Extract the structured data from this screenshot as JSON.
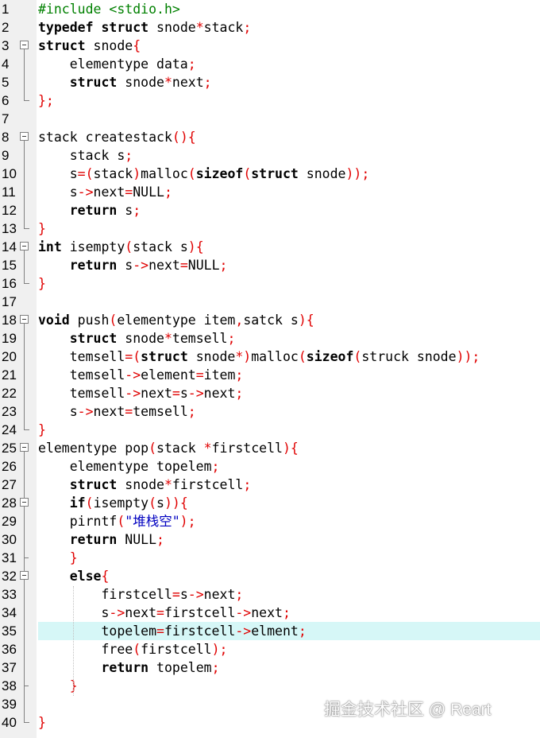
{
  "editor": {
    "colors": {
      "keyword": "#000000",
      "preprocessor": "#008000",
      "operator": "#e00000",
      "text": "#000000",
      "string": "#0000c0",
      "line_highlight": "#d6f7f7",
      "gutter": "#f0f0f0"
    },
    "highlighted_line": 35,
    "lines": [
      {
        "n": "1",
        "fold": "",
        "tokens": [
          [
            "pp",
            "#include <stdio.h>"
          ]
        ]
      },
      {
        "n": "2",
        "fold": "",
        "tokens": [
          [
            "kw",
            "typedef"
          ],
          [
            "tx",
            " "
          ],
          [
            "kw",
            "struct"
          ],
          [
            "tx",
            " snode"
          ],
          [
            "op",
            "*"
          ],
          [
            "tx",
            "stack"
          ],
          [
            "op",
            ";"
          ]
        ]
      },
      {
        "n": "3",
        "fold": "open",
        "tokens": [
          [
            "kw",
            "struct"
          ],
          [
            "tx",
            " snode"
          ],
          [
            "op",
            "{"
          ]
        ]
      },
      {
        "n": "4",
        "fold": "line",
        "tokens": [
          [
            "tx",
            "    elementype data"
          ],
          [
            "op",
            ";"
          ]
        ]
      },
      {
        "n": "5",
        "fold": "line",
        "tokens": [
          [
            "tx",
            "    "
          ],
          [
            "kw",
            "struct"
          ],
          [
            "tx",
            " snode"
          ],
          [
            "op",
            "*"
          ],
          [
            "tx",
            "next"
          ],
          [
            "op",
            ";"
          ]
        ]
      },
      {
        "n": "6",
        "fold": "end",
        "tokens": [
          [
            "op",
            "};"
          ]
        ]
      },
      {
        "n": "7",
        "fold": "",
        "tokens": []
      },
      {
        "n": "8",
        "fold": "open",
        "tokens": [
          [
            "tx",
            "stack createstack"
          ],
          [
            "op",
            "(){"
          ]
        ]
      },
      {
        "n": "9",
        "fold": "line",
        "tokens": [
          [
            "tx",
            "    stack s"
          ],
          [
            "op",
            ";"
          ]
        ]
      },
      {
        "n": "10",
        "fold": "line",
        "tokens": [
          [
            "tx",
            "    s"
          ],
          [
            "op",
            "=("
          ],
          [
            "tx",
            "stack"
          ],
          [
            "op",
            ")"
          ],
          [
            "tx",
            "malloc"
          ],
          [
            "op",
            "("
          ],
          [
            "kw",
            "sizeof"
          ],
          [
            "op",
            "("
          ],
          [
            "kw",
            "struct"
          ],
          [
            "tx",
            " snode"
          ],
          [
            "op",
            "));"
          ]
        ]
      },
      {
        "n": "11",
        "fold": "line",
        "tokens": [
          [
            "tx",
            "    s"
          ],
          [
            "op",
            "->"
          ],
          [
            "tx",
            "next"
          ],
          [
            "op",
            "="
          ],
          [
            "tx",
            "NULL"
          ],
          [
            "op",
            ";"
          ]
        ]
      },
      {
        "n": "12",
        "fold": "line",
        "tokens": [
          [
            "tx",
            "    "
          ],
          [
            "kw",
            "return"
          ],
          [
            "tx",
            " s"
          ],
          [
            "op",
            ";"
          ]
        ]
      },
      {
        "n": "13",
        "fold": "end",
        "tokens": [
          [
            "op",
            "}"
          ]
        ]
      },
      {
        "n": "14",
        "fold": "open",
        "tokens": [
          [
            "kw",
            "int"
          ],
          [
            "tx",
            " isempty"
          ],
          [
            "op",
            "("
          ],
          [
            "tx",
            "stack s"
          ],
          [
            "op",
            "){"
          ]
        ]
      },
      {
        "n": "15",
        "fold": "line",
        "tokens": [
          [
            "tx",
            "    "
          ],
          [
            "kw",
            "return"
          ],
          [
            "tx",
            " s"
          ],
          [
            "op",
            "->"
          ],
          [
            "tx",
            "next"
          ],
          [
            "op",
            "="
          ],
          [
            "tx",
            "NULL"
          ],
          [
            "op",
            ";"
          ]
        ]
      },
      {
        "n": "16",
        "fold": "end",
        "tokens": [
          [
            "op",
            "}"
          ]
        ]
      },
      {
        "n": "17",
        "fold": "",
        "tokens": []
      },
      {
        "n": "18",
        "fold": "open",
        "tokens": [
          [
            "kw",
            "void"
          ],
          [
            "tx",
            " push"
          ],
          [
            "op",
            "("
          ],
          [
            "tx",
            "elementype item"
          ],
          [
            "op",
            ","
          ],
          [
            "tx",
            "satck s"
          ],
          [
            "op",
            "){"
          ]
        ]
      },
      {
        "n": "19",
        "fold": "line",
        "tokens": [
          [
            "tx",
            "    "
          ],
          [
            "kw",
            "struct"
          ],
          [
            "tx",
            " snode"
          ],
          [
            "op",
            "*"
          ],
          [
            "tx",
            "temsell"
          ],
          [
            "op",
            ";"
          ]
        ]
      },
      {
        "n": "20",
        "fold": "line",
        "tokens": [
          [
            "tx",
            "    temsell"
          ],
          [
            "op",
            "=("
          ],
          [
            "kw",
            "struct"
          ],
          [
            "tx",
            " snode"
          ],
          [
            "op",
            "*)"
          ],
          [
            "tx",
            "malloc"
          ],
          [
            "op",
            "("
          ],
          [
            "kw",
            "sizeof"
          ],
          [
            "op",
            "("
          ],
          [
            "tx",
            "struck snode"
          ],
          [
            "op",
            "));"
          ]
        ]
      },
      {
        "n": "21",
        "fold": "line",
        "tokens": [
          [
            "tx",
            "    temsell"
          ],
          [
            "op",
            "->"
          ],
          [
            "tx",
            "element"
          ],
          [
            "op",
            "="
          ],
          [
            "tx",
            "item"
          ],
          [
            "op",
            ";"
          ]
        ]
      },
      {
        "n": "22",
        "fold": "line",
        "tokens": [
          [
            "tx",
            "    temsell"
          ],
          [
            "op",
            "->"
          ],
          [
            "tx",
            "next"
          ],
          [
            "op",
            "="
          ],
          [
            "tx",
            "s"
          ],
          [
            "op",
            "->"
          ],
          [
            "tx",
            "next"
          ],
          [
            "op",
            ";"
          ]
        ]
      },
      {
        "n": "23",
        "fold": "line",
        "tokens": [
          [
            "tx",
            "    s"
          ],
          [
            "op",
            "->"
          ],
          [
            "tx",
            "next"
          ],
          [
            "op",
            "="
          ],
          [
            "tx",
            "temsell"
          ],
          [
            "op",
            ";"
          ]
        ]
      },
      {
        "n": "24",
        "fold": "end",
        "tokens": [
          [
            "op",
            "}"
          ]
        ]
      },
      {
        "n": "25",
        "fold": "open",
        "tokens": [
          [
            "tx",
            "elementype pop"
          ],
          [
            "op",
            "("
          ],
          [
            "tx",
            "stack "
          ],
          [
            "op",
            "*"
          ],
          [
            "tx",
            "firstcell"
          ],
          [
            "op",
            "){"
          ]
        ]
      },
      {
        "n": "26",
        "fold": "line",
        "tokens": [
          [
            "tx",
            "    elementype topelem"
          ],
          [
            "op",
            ";"
          ]
        ]
      },
      {
        "n": "27",
        "fold": "line",
        "tokens": [
          [
            "tx",
            "    "
          ],
          [
            "kw",
            "struct"
          ],
          [
            "tx",
            " snode"
          ],
          [
            "op",
            "*"
          ],
          [
            "tx",
            "firstcell"
          ],
          [
            "op",
            ";"
          ]
        ]
      },
      {
        "n": "28",
        "fold": "open",
        "tokens": [
          [
            "tx",
            "    "
          ],
          [
            "kw",
            "if"
          ],
          [
            "op",
            "("
          ],
          [
            "tx",
            "isempty"
          ],
          [
            "op",
            "("
          ],
          [
            "tx",
            "s"
          ],
          [
            "op",
            ")){"
          ]
        ]
      },
      {
        "n": "29",
        "fold": "line",
        "tokens": [
          [
            "tx",
            "    pirntf"
          ],
          [
            "op",
            "("
          ],
          [
            "st",
            "\"堆栈空\""
          ],
          [
            "op",
            ");"
          ]
        ]
      },
      {
        "n": "30",
        "fold": "line",
        "tokens": [
          [
            "tx",
            "    "
          ],
          [
            "kw",
            "return"
          ],
          [
            "tx",
            " NULL"
          ],
          [
            "op",
            ";"
          ]
        ]
      },
      {
        "n": "31",
        "fold": "mid",
        "tokens": [
          [
            "tx",
            "    "
          ],
          [
            "op",
            "}"
          ]
        ]
      },
      {
        "n": "32",
        "fold": "open",
        "tokens": [
          [
            "tx",
            "    "
          ],
          [
            "kw",
            "else"
          ],
          [
            "op",
            "{"
          ]
        ]
      },
      {
        "n": "33",
        "fold": "line",
        "tokens": [
          [
            "tx",
            "        firstcell"
          ],
          [
            "op",
            "="
          ],
          [
            "tx",
            "s"
          ],
          [
            "op",
            "->"
          ],
          [
            "tx",
            "next"
          ],
          [
            "op",
            ";"
          ]
        ]
      },
      {
        "n": "34",
        "fold": "line",
        "tokens": [
          [
            "tx",
            "        s"
          ],
          [
            "op",
            "->"
          ],
          [
            "tx",
            "next"
          ],
          [
            "op",
            "="
          ],
          [
            "tx",
            "firstcell"
          ],
          [
            "op",
            "->"
          ],
          [
            "tx",
            "next"
          ],
          [
            "op",
            ";"
          ]
        ]
      },
      {
        "n": "35",
        "fold": "line",
        "tokens": [
          [
            "tx",
            "        topelem"
          ],
          [
            "op",
            "="
          ],
          [
            "tx",
            "firstcell"
          ],
          [
            "op",
            "->"
          ],
          [
            "tx",
            "elment"
          ],
          [
            "op",
            ";"
          ]
        ]
      },
      {
        "n": "36",
        "fold": "line",
        "tokens": [
          [
            "tx",
            "        free"
          ],
          [
            "op",
            "("
          ],
          [
            "tx",
            "firstcell"
          ],
          [
            "op",
            ");"
          ]
        ]
      },
      {
        "n": "37",
        "fold": "line",
        "tokens": [
          [
            "tx",
            "        "
          ],
          [
            "kw",
            "return"
          ],
          [
            "tx",
            " topelem"
          ],
          [
            "op",
            ";"
          ]
        ]
      },
      {
        "n": "38",
        "fold": "mid",
        "tokens": [
          [
            "tx",
            "    "
          ],
          [
            "op",
            "}"
          ]
        ]
      },
      {
        "n": "39",
        "fold": "line",
        "tokens": []
      },
      {
        "n": "40",
        "fold": "end",
        "tokens": [
          [
            "op",
            "}"
          ]
        ]
      }
    ]
  },
  "watermark": {
    "text": "掘金技术社区 @ Reart"
  }
}
